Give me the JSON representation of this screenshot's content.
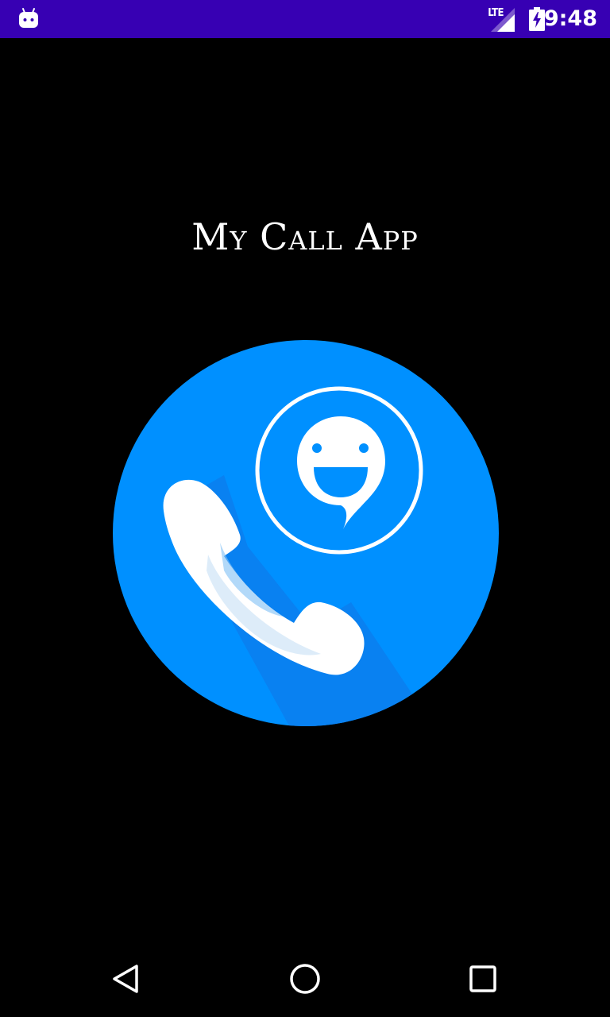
{
  "status_bar": {
    "network_label": "LTE",
    "time": "9:48",
    "icons": [
      "android-debug-icon",
      "signal-icon",
      "battery-charging-icon"
    ],
    "background_color": "#3700b3"
  },
  "app": {
    "title": "My Call App",
    "logo_icon": "call-app-logo-icon",
    "logo_color": "#0090ff"
  },
  "navigation": {
    "buttons": [
      "back-icon",
      "home-icon",
      "recents-icon"
    ]
  }
}
